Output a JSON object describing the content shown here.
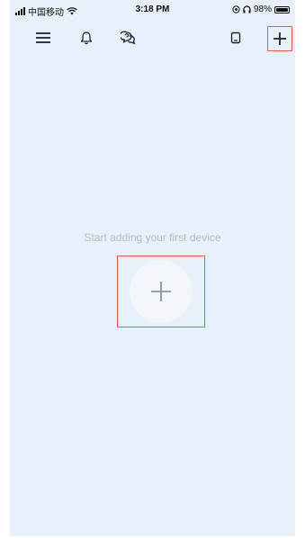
{
  "status_bar": {
    "carrier": "中国移动",
    "time": "3:18 PM",
    "battery_text": "98%",
    "battery_level": 0.98,
    "icons": [
      "signal-icon",
      "wifi-icon",
      "location-icon",
      "headphone-icon",
      "battery-icon"
    ]
  },
  "toolbar": {
    "icons": [
      "menu-icon",
      "bell-icon",
      "chat-icon",
      "device-icon",
      "plus-icon"
    ]
  },
  "empty_state": {
    "message": "Start adding your first device",
    "icon": "plus-icon"
  },
  "colors": {
    "background": "#e7f0fb",
    "highlight": "#e8604c",
    "muted_text": "#b3bcc8",
    "add_circle": "#f2f6fb",
    "icon_dark": "#1f2530",
    "icon_muted": "#8a93a0"
  }
}
